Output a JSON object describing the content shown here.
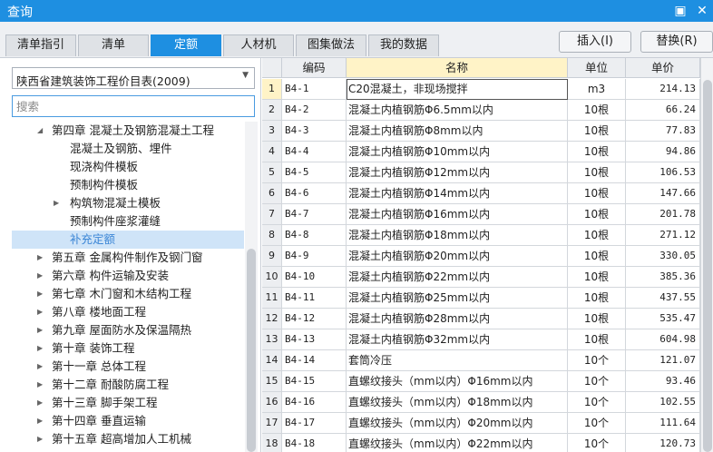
{
  "window": {
    "title": "查询",
    "pin_glyph": "▣",
    "close_glyph": "✕"
  },
  "tabs": [
    {
      "label": "清单指引",
      "active": false
    },
    {
      "label": "清单",
      "active": false
    },
    {
      "label": "定额",
      "active": true
    },
    {
      "label": "人材机",
      "active": false
    },
    {
      "label": "图集做法",
      "active": false
    },
    {
      "label": "我的数据",
      "active": false
    }
  ],
  "actions": {
    "insert_label": "插入(I)",
    "replace_label": "替换(R)"
  },
  "left_panel": {
    "library_selected": "陕西省建筑装饰工程价目表(2009)",
    "search_placeholder": "搜索",
    "tree": [
      {
        "label": "第四章 混凝土及钢筋混凝土工程",
        "level": 1,
        "arrow": "◢",
        "selected": false
      },
      {
        "label": "混凝土及钢筋、埋件",
        "level": 2,
        "arrow": "",
        "selected": false
      },
      {
        "label": "现浇构件模板",
        "level": 2,
        "arrow": "",
        "selected": false
      },
      {
        "label": "预制构件模板",
        "level": 2,
        "arrow": "",
        "selected": false
      },
      {
        "label": "构筑物混凝土模板",
        "level": 2,
        "arrow": "▶",
        "selected": false
      },
      {
        "label": "预制构件座浆灌缝",
        "level": 2,
        "arrow": "",
        "selected": false
      },
      {
        "label": "补充定额",
        "level": 2,
        "arrow": "",
        "selected": true
      },
      {
        "label": "第五章 金属构件制作及钢门窗",
        "level": 1,
        "arrow": "▶",
        "selected": false
      },
      {
        "label": "第六章 构件运输及安装",
        "level": 1,
        "arrow": "▶",
        "selected": false
      },
      {
        "label": "第七章 木门窗和木结构工程",
        "level": 1,
        "arrow": "▶",
        "selected": false
      },
      {
        "label": "第八章 楼地面工程",
        "level": 1,
        "arrow": "▶",
        "selected": false
      },
      {
        "label": "第九章 屋面防水及保温隔热",
        "level": 1,
        "arrow": "▶",
        "selected": false
      },
      {
        "label": "第十章 装饰工程",
        "level": 1,
        "arrow": "▶",
        "selected": false
      },
      {
        "label": "第十一章 总体工程",
        "level": 1,
        "arrow": "▶",
        "selected": false
      },
      {
        "label": "第十二章 耐酸防腐工程",
        "level": 1,
        "arrow": "▶",
        "selected": false
      },
      {
        "label": "第十三章 脚手架工程",
        "level": 1,
        "arrow": "▶",
        "selected": false
      },
      {
        "label": "第十四章 垂直运输",
        "level": 1,
        "arrow": "▶",
        "selected": false
      },
      {
        "label": "第十五章 超高增加人工机械",
        "level": 1,
        "arrow": "▶",
        "selected": false
      }
    ]
  },
  "table": {
    "headers": {
      "code": "编码",
      "name": "名称",
      "unit": "单位",
      "price": "单价"
    },
    "rows": [
      {
        "num": "1",
        "code": "B4-1",
        "name": "C20混凝土，非现场搅拌",
        "unit": "m3",
        "price": "214.13"
      },
      {
        "num": "2",
        "code": "B4-2",
        "name": "混凝土内植钢筋Φ6.5mm以内",
        "unit": "10根",
        "price": "66.24"
      },
      {
        "num": "3",
        "code": "B4-3",
        "name": "混凝土内植钢筋Φ8mm以内",
        "unit": "10根",
        "price": "77.83"
      },
      {
        "num": "4",
        "code": "B4-4",
        "name": "混凝土内植钢筋Φ10mm以内",
        "unit": "10根",
        "price": "94.86"
      },
      {
        "num": "5",
        "code": "B4-5",
        "name": "混凝土内植钢筋Φ12mm以内",
        "unit": "10根",
        "price": "106.53"
      },
      {
        "num": "6",
        "code": "B4-6",
        "name": "混凝土内植钢筋Φ14mm以内",
        "unit": "10根",
        "price": "147.66"
      },
      {
        "num": "7",
        "code": "B4-7",
        "name": "混凝土内植钢筋Φ16mm以内",
        "unit": "10根",
        "price": "201.78"
      },
      {
        "num": "8",
        "code": "B4-8",
        "name": "混凝土内植钢筋Φ18mm以内",
        "unit": "10根",
        "price": "271.12"
      },
      {
        "num": "9",
        "code": "B4-9",
        "name": "混凝土内植钢筋Φ20mm以内",
        "unit": "10根",
        "price": "330.05"
      },
      {
        "num": "10",
        "code": "B4-10",
        "name": "混凝土内植钢筋Φ22mm以内",
        "unit": "10根",
        "price": "385.36"
      },
      {
        "num": "11",
        "code": "B4-11",
        "name": "混凝土内植钢筋Φ25mm以内",
        "unit": "10根",
        "price": "437.55"
      },
      {
        "num": "12",
        "code": "B4-12",
        "name": "混凝土内植钢筋Φ28mm以内",
        "unit": "10根",
        "price": "535.47"
      },
      {
        "num": "13",
        "code": "B4-13",
        "name": "混凝土内植钢筋Φ32mm以内",
        "unit": "10根",
        "price": "604.98"
      },
      {
        "num": "14",
        "code": "B4-14",
        "name": "套筒冷压",
        "unit": "10个",
        "price": "121.07"
      },
      {
        "num": "15",
        "code": "B4-15",
        "name": "直螺纹接头（mm以内）Φ16mm以内",
        "unit": "10个",
        "price": "93.46"
      },
      {
        "num": "16",
        "code": "B4-16",
        "name": "直螺纹接头（mm以内）Φ18mm以内",
        "unit": "10个",
        "price": "102.55"
      },
      {
        "num": "17",
        "code": "B4-17",
        "name": "直螺纹接头（mm以内）Φ20mm以内",
        "unit": "10个",
        "price": "111.64"
      },
      {
        "num": "18",
        "code": "B4-18",
        "name": "直螺纹接头（mm以内）Φ22mm以内",
        "unit": "10个",
        "price": "120.73"
      }
    ]
  }
}
